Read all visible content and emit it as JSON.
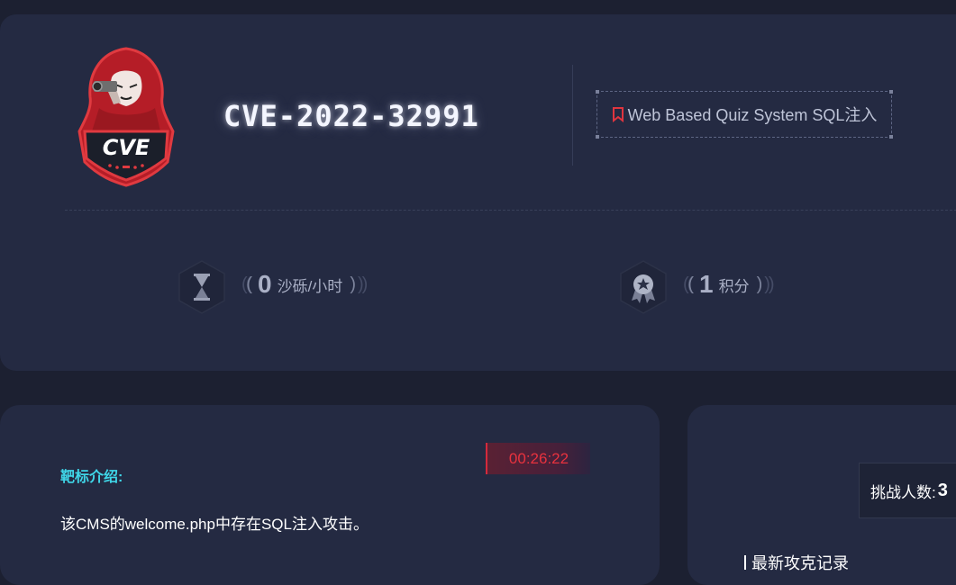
{
  "header": {
    "title": "CVE-2022-32991",
    "logo_text": "CVE",
    "tag": {
      "icon": "bookmark-icon",
      "label": "Web Based Quiz System SQL注入"
    }
  },
  "stats": [
    {
      "icon": "hourglass-icon",
      "value": "0",
      "unit": "沙砾/小时"
    },
    {
      "icon": "medal-icon",
      "value": "1",
      "unit": "积分"
    }
  ],
  "target": {
    "timer": "00:26:22",
    "intro_label": "靶标介绍:",
    "intro_text": "该CMS的welcome.php中存在SQL注入攻击。"
  },
  "side": {
    "challengers_label": "挑战人数:",
    "challengers_count": "3",
    "latest_title": "最新攻克记录"
  },
  "colors": {
    "background": "#1c2031",
    "card": "#242a42",
    "accent_cyan": "#3fd6e8",
    "accent_red": "#e8323e"
  }
}
